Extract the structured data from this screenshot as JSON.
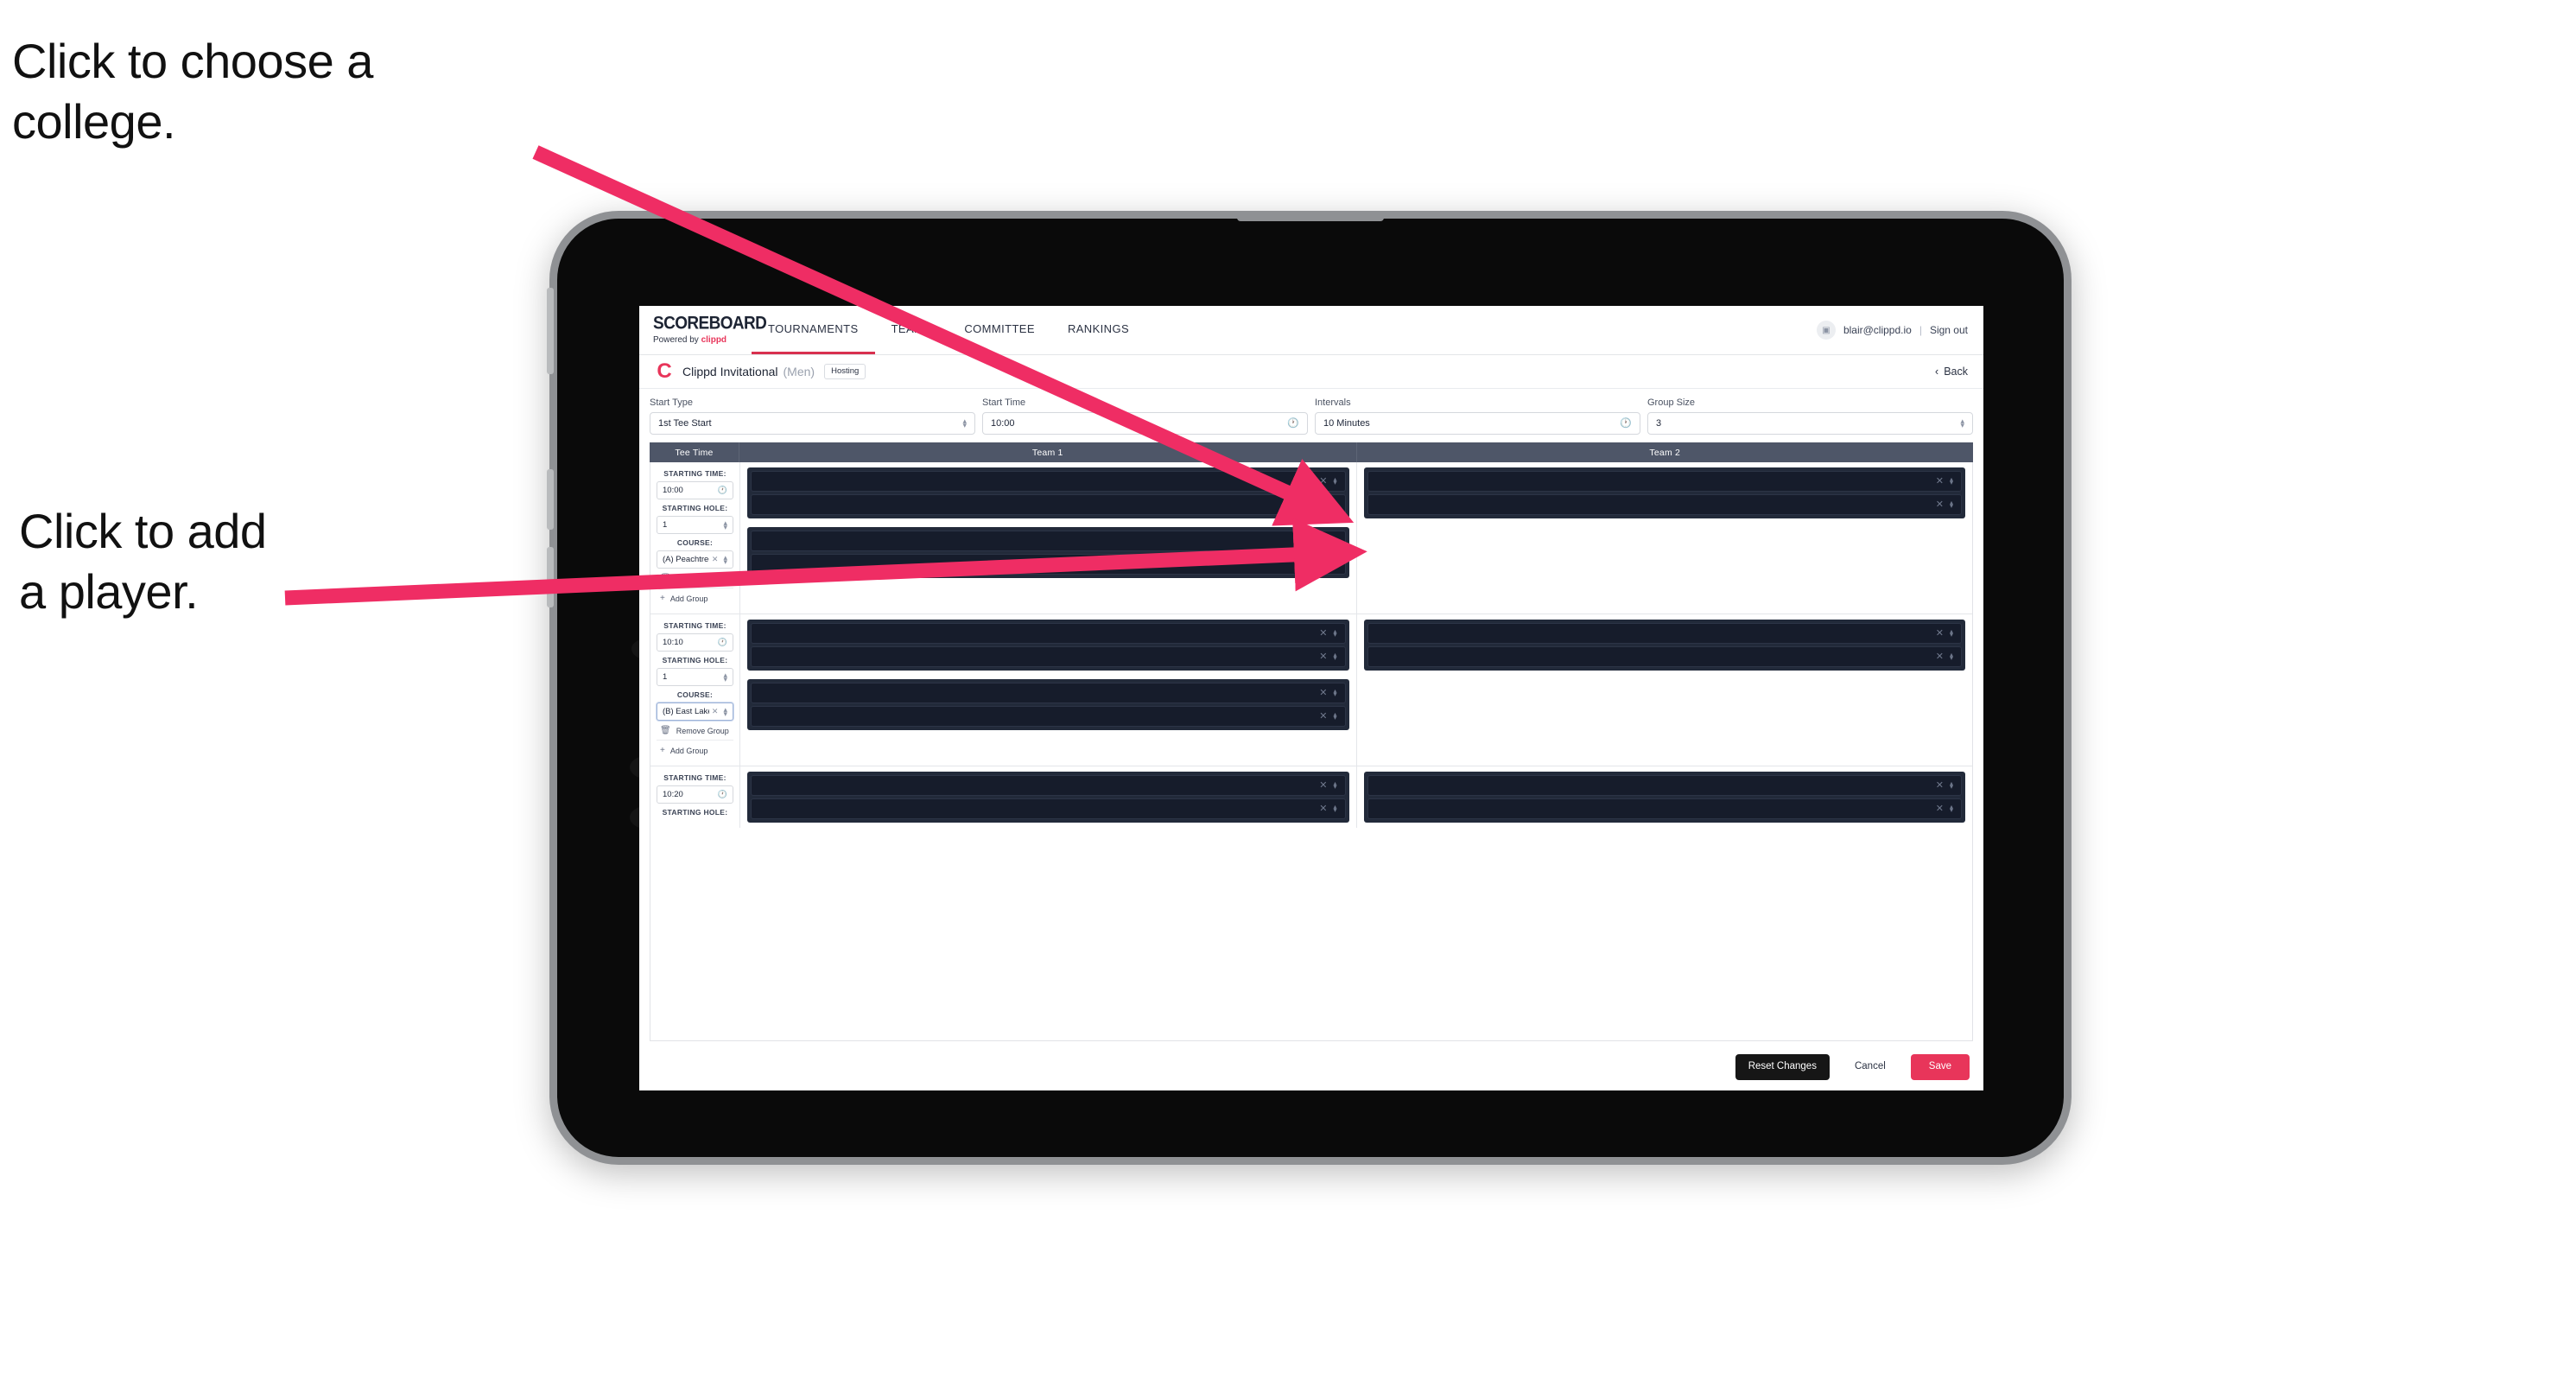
{
  "annotations": {
    "choose_college": "Click to choose a\ncollege.",
    "add_player": "Click to add\na player."
  },
  "colors": {
    "accent_pink": "#e8355a",
    "annotation_arrow": "#ef2d64",
    "nav_active_underline": "#d8304f",
    "table_header_bg": "#4e5668",
    "player_panel_bg": "#222a3a",
    "player_row_bg": "#161c2b",
    "reset_button_bg": "#161616"
  },
  "appbar": {
    "brand_title": "SCOREBOARD",
    "brand_sub_prefix": "Powered by ",
    "brand_sub_name": "clippd",
    "nav": [
      {
        "label": "TOURNAMENTS",
        "active": true
      },
      {
        "label": "TEAMS",
        "active": false
      },
      {
        "label": "COMMITTEE",
        "active": false
      },
      {
        "label": "RANKINGS",
        "active": false
      }
    ],
    "account": {
      "avatar_icon": "user-icon",
      "email": "blair@clippd.io",
      "separator": "|",
      "sign_out": "Sign out"
    }
  },
  "tournament": {
    "logo_glyph": "C",
    "name": "Clippd Invitational",
    "gender": "(Men)",
    "badge": "Hosting",
    "back_chevron": "‹",
    "back_label": "Back"
  },
  "filters": [
    {
      "label": "Start Type",
      "value": "1st Tee Start",
      "icon": "stepper-icon"
    },
    {
      "label": "Start Time",
      "value": "10:00",
      "icon": "clock-icon"
    },
    {
      "label": "Intervals",
      "value": "10 Minutes",
      "icon": "clock-icon"
    },
    {
      "label": "Group Size",
      "value": "3",
      "icon": "stepper-icon"
    }
  ],
  "table": {
    "headers": [
      "Tee Time",
      "Team 1",
      "Team 2"
    ],
    "labels": {
      "starting_time": "STARTING TIME:",
      "starting_hole": "STARTING HOLE:",
      "course": "COURSE:",
      "remove_group": "Remove Group",
      "add_group": "Add Group"
    },
    "rows": [
      {
        "starting_time": "10:00",
        "starting_hole": "1",
        "course": "(A) Peachtree GC",
        "course_focused": false,
        "team1_groups": [
          2,
          2
        ],
        "team2_groups": [
          2
        ]
      },
      {
        "starting_time": "10:10",
        "starting_hole": "1",
        "course": "(B) East Lake GC",
        "course_focused": true,
        "team1_groups": [
          2,
          2
        ],
        "team2_groups": [
          2
        ]
      },
      {
        "starting_time": "10:20",
        "starting_hole": "",
        "course": "",
        "course_focused": false,
        "team1_groups": [
          2
        ],
        "team2_groups": [
          2
        ]
      }
    ]
  },
  "footer": {
    "reset": "Reset Changes",
    "cancel": "Cancel",
    "save": "Save"
  }
}
